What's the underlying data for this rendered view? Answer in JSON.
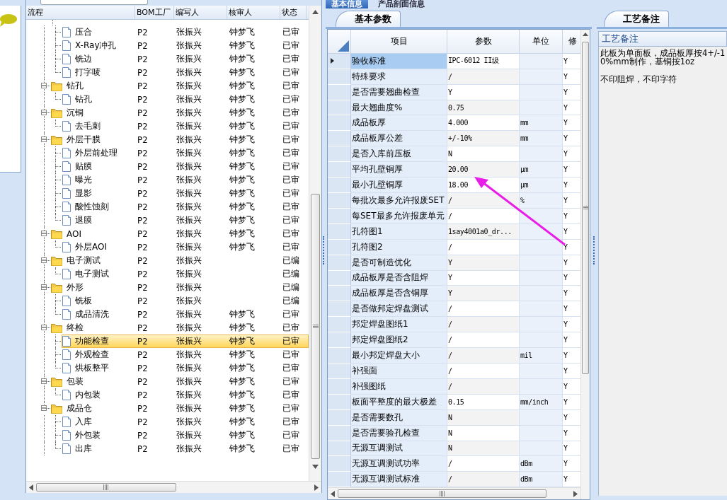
{
  "top_tabs": [
    {
      "label": "基本信息",
      "selected": true
    },
    {
      "label": "产品剖面信息",
      "selected": false
    }
  ],
  "tree": {
    "columns": [
      "流程",
      "BOM工厂",
      "编写人",
      "核审人",
      "状态"
    ],
    "nodes": [
      {
        "kind": "continued",
        "children": [
          {
            "name": "压合",
            "factory": "P2",
            "writer": "张振兴",
            "reviewer": "钟梦飞",
            "status": "已审",
            "selected": false
          },
          {
            "name": "X-Ray冲孔",
            "factory": "P2",
            "writer": "张振兴",
            "reviewer": "钟梦飞",
            "status": "已审",
            "selected": false
          },
          {
            "name": "铣边",
            "factory": "P2",
            "writer": "张振兴",
            "reviewer": "钟梦飞",
            "status": "已审",
            "selected": false
          },
          {
            "name": "打字唛",
            "factory": "P2",
            "writer": "张振兴",
            "reviewer": "钟梦飞",
            "status": "已审",
            "selected": false
          }
        ]
      },
      {
        "kind": "group",
        "name": "钻孔",
        "factory": "P2",
        "writer": "张振兴",
        "reviewer": "钟梦飞",
        "status": "已审",
        "selected": false,
        "expanded": true,
        "children": [
          {
            "name": "钻孔",
            "factory": "P2",
            "writer": "张振兴",
            "reviewer": "钟梦飞",
            "status": "已审",
            "selected": false
          }
        ]
      },
      {
        "kind": "group",
        "name": "沉铜",
        "factory": "P2",
        "writer": "张振兴",
        "reviewer": "钟梦飞",
        "status": "已审",
        "selected": false,
        "expanded": true,
        "children": [
          {
            "name": "去毛刺",
            "factory": "P2",
            "writer": "张振兴",
            "reviewer": "钟梦飞",
            "status": "已审",
            "selected": false
          }
        ]
      },
      {
        "kind": "group",
        "name": "外层干膜",
        "factory": "P2",
        "writer": "张振兴",
        "reviewer": "钟梦飞",
        "status": "已审",
        "selected": false,
        "expanded": true,
        "children": [
          {
            "name": "外层前处理",
            "factory": "P2",
            "writer": "张振兴",
            "reviewer": "钟梦飞",
            "status": "已审",
            "selected": false
          },
          {
            "name": "贴膜",
            "factory": "P2",
            "writer": "张振兴",
            "reviewer": "钟梦飞",
            "status": "已审",
            "selected": false
          },
          {
            "name": "曝光",
            "factory": "P2",
            "writer": "张振兴",
            "reviewer": "钟梦飞",
            "status": "已审",
            "selected": false
          },
          {
            "name": "显影",
            "factory": "P2",
            "writer": "张振兴",
            "reviewer": "钟梦飞",
            "status": "已审",
            "selected": false
          },
          {
            "name": "酸性蚀刻",
            "factory": "P2",
            "writer": "张振兴",
            "reviewer": "钟梦飞",
            "status": "已审",
            "selected": false
          },
          {
            "name": "退膜",
            "factory": "P2",
            "writer": "张振兴",
            "reviewer": "钟梦飞",
            "status": "已审",
            "selected": false
          }
        ]
      },
      {
        "kind": "group",
        "name": "AOI",
        "factory": "P2",
        "writer": "张振兴",
        "reviewer": "钟梦飞",
        "status": "已审",
        "selected": false,
        "expanded": true,
        "children": [
          {
            "name": "外层AOI",
            "factory": "P2",
            "writer": "张振兴",
            "reviewer": "钟梦飞",
            "status": "已审",
            "selected": false
          }
        ]
      },
      {
        "kind": "group",
        "name": "电子测试",
        "factory": "P2",
        "writer": "张振兴",
        "status": "已编",
        "selected": false,
        "expanded": true,
        "children": [
          {
            "name": "电子测试",
            "factory": "P2",
            "writer": "张振兴",
            "status": "已编",
            "selected": false
          }
        ]
      },
      {
        "kind": "group",
        "name": "外形",
        "factory": "P2",
        "writer": "张振兴",
        "status": "已编",
        "selected": false,
        "expanded": true,
        "children": [
          {
            "name": "铣板",
            "factory": "P2",
            "writer": "张振兴",
            "status": "已编",
            "selected": false
          },
          {
            "name": "成品清洗",
            "factory": "P2",
            "writer": "张振兴",
            "reviewer": "钟梦飞",
            "status": "已审",
            "selected": false
          }
        ]
      },
      {
        "kind": "group",
        "name": "终检",
        "factory": "P2",
        "writer": "张振兴",
        "reviewer": "钟梦飞",
        "status": "已审",
        "selected": false,
        "expanded": true,
        "children": [
          {
            "name": "功能检查",
            "factory": "P2",
            "writer": "张振兴",
            "reviewer": "钟梦飞",
            "status": "已审",
            "selected": true
          },
          {
            "name": "外观检查",
            "factory": "P2",
            "writer": "张振兴",
            "reviewer": "钟梦飞",
            "status": "已审",
            "selected": false
          },
          {
            "name": "烘板整平",
            "factory": "P2",
            "writer": "张振兴",
            "reviewer": "钟梦飞",
            "status": "已审",
            "selected": false
          }
        ]
      },
      {
        "kind": "group",
        "name": "包装",
        "factory": "P2",
        "writer": "张振兴",
        "reviewer": "钟梦飞",
        "status": "已审",
        "selected": false,
        "expanded": true,
        "children": [
          {
            "name": "内包装",
            "factory": "P2",
            "writer": "张振兴",
            "reviewer": "钟梦飞",
            "status": "已审",
            "selected": false
          }
        ]
      },
      {
        "kind": "group",
        "name": "成品仓",
        "factory": "P2",
        "writer": "张振兴",
        "reviewer": "钟梦飞",
        "status": "已审",
        "selected": false,
        "expanded": true,
        "children": [
          {
            "name": "入库",
            "factory": "P2",
            "writer": "张振兴",
            "reviewer": "钟梦飞",
            "status": "已审",
            "selected": false
          },
          {
            "name": "外包装",
            "factory": "P2",
            "writer": "张振兴",
            "reviewer": "钟梦飞",
            "status": "已审",
            "selected": false
          },
          {
            "name": "出库",
            "factory": "P2",
            "writer": "张振兴",
            "reviewer": "钟梦飞",
            "status": "已审",
            "selected": false
          }
        ]
      }
    ]
  },
  "params": {
    "tab": "基本参数",
    "columns": [
      "项目",
      "参数",
      "单位",
      "修"
    ],
    "rows": [
      {
        "item": "验收标准",
        "value": "IPC-6012 II级",
        "flag": "Y",
        "selected": true
      },
      {
        "item": "特殊要求",
        "value": "/",
        "flag": "Y",
        "selected": false
      },
      {
        "item": "是否需要翘曲检查",
        "value": "Y",
        "flag": "Y",
        "selected": false
      },
      {
        "item": "最大翘曲度%",
        "value": "0.75",
        "flag": "Y",
        "selected": false
      },
      {
        "item": "成品板厚",
        "value": "4.000",
        "unit": "mm",
        "flag": "Y",
        "selected": false
      },
      {
        "item": "成品板厚公差",
        "value": "+/-10%",
        "unit": "mm",
        "flag": "Y",
        "selected": false
      },
      {
        "item": "是否入库前压板",
        "value": "N",
        "flag": "Y",
        "selected": false
      },
      {
        "item": "平均孔壁铜厚",
        "value": "20.00",
        "unit": "μm",
        "flag": "Y",
        "selected": false
      },
      {
        "item": "最小孔壁铜厚",
        "value": "18.00",
        "unit": "μm",
        "flag": "Y",
        "selected": false
      },
      {
        "item": "每批次最多允许报废SET",
        "value": "/",
        "unit": "%",
        "flag": "Y",
        "selected": false
      },
      {
        "item": "每SET最多允许报废单元",
        "value": "/",
        "flag": "Y",
        "selected": false
      },
      {
        "item": "孔符图1",
        "value": "1say4001a0_dr...",
        "flag": "Y",
        "selected": false
      },
      {
        "item": "孔符图2",
        "value": "/",
        "flag": "Y",
        "selected": false
      },
      {
        "item": "是否可制造优化",
        "value": "Y",
        "flag": "Y",
        "selected": false
      },
      {
        "item": "成品板厚是否含阻焊",
        "value": "Y",
        "flag": "Y",
        "selected": false
      },
      {
        "item": "成品板厚是否含铜厚",
        "value": "Y",
        "flag": "Y",
        "selected": false
      },
      {
        "item": "是否做邦定焊盘测试",
        "value": "/",
        "flag": "Y",
        "selected": false
      },
      {
        "item": "邦定焊盘图纸1",
        "value": "/",
        "flag": "Y",
        "selected": false
      },
      {
        "item": "邦定焊盘图纸2",
        "value": "/",
        "flag": "Y",
        "selected": false
      },
      {
        "item": "最小邦定焊盘大小",
        "value": "/",
        "unit": "mil",
        "flag": "Y",
        "selected": false
      },
      {
        "item": "补强面",
        "value": "/",
        "flag": "Y",
        "selected": false
      },
      {
        "item": "补强图纸",
        "value": "/",
        "flag": "Y",
        "selected": false
      },
      {
        "item": "板面平整度的最大极差",
        "value": "0.15",
        "unit": "mm/inch",
        "flag": "Y",
        "selected": false
      },
      {
        "item": "是否需要数孔",
        "value": "N",
        "flag": "Y",
        "selected": false
      },
      {
        "item": "是否需要验孔检查",
        "value": "N",
        "flag": "Y",
        "selected": false
      },
      {
        "item": "无源互调测试",
        "value": "N",
        "flag": "Y",
        "selected": false
      },
      {
        "item": "无源互调测试功率",
        "value": "/",
        "unit": "dBm",
        "flag": "Y",
        "selected": false
      },
      {
        "item": "无源互调测试标准",
        "value": "/",
        "unit": "dBm",
        "flag": "Y",
        "selected": false
      }
    ]
  },
  "notes": {
    "tab": "工艺备注",
    "header": "工艺备注",
    "paragraphs": [
      "此板为单面板，成品板厚按4+/-10%mm制作，基铜按1oz",
      "不印阻焊，不印字符"
    ]
  }
}
